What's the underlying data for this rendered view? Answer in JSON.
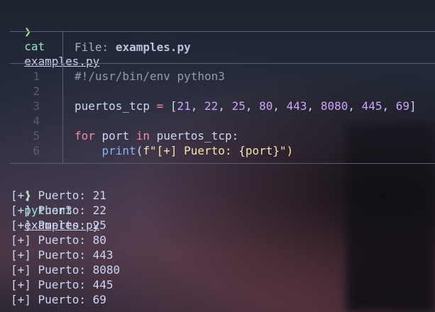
{
  "prompt1": {
    "symbol": "❯",
    "command": "cat",
    "file": "examples.py"
  },
  "bat": {
    "file_label": "File:",
    "file_name": "examples.py",
    "line_numbers": [
      "1",
      "2",
      "3",
      "4",
      "5",
      "6"
    ],
    "code": {
      "shebang": "#!/usr/bin/env python3",
      "var": "puertos_tcp",
      "assign": "=",
      "ports": [
        "21",
        "22",
        "25",
        "80",
        "443",
        "8080",
        "445",
        "69"
      ],
      "for_kw": "for",
      "loop_var": "port",
      "in_kw": "in",
      "iter": "puertos_tcp:",
      "print_fn": "print",
      "fstring": "f\"[+] Puerto: {port}\")"
    }
  },
  "prompt2": {
    "symbol": "❯",
    "command": "python3",
    "file": "examples.py"
  },
  "output": [
    "[+] Puerto: 21",
    "[+] Puerto: 22",
    "[+] Puerto: 25",
    "[+] Puerto: 80",
    "[+] Puerto: 443",
    "[+] Puerto: 8080",
    "[+] Puerto: 445",
    "[+] Puerto: 69"
  ]
}
